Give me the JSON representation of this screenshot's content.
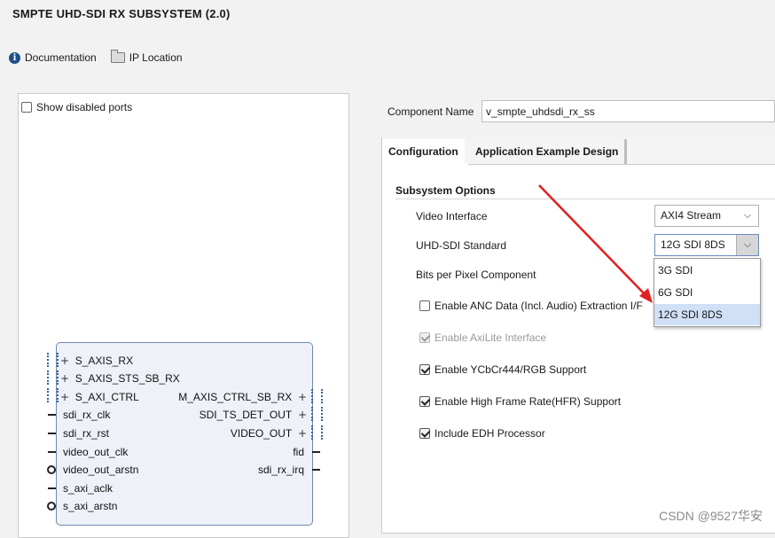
{
  "window": {
    "title": "SMPTE UHD-SDI RX SUBSYSTEM (2.0)"
  },
  "toolbar": {
    "documentation": "Documentation",
    "ip_location": "IP Location"
  },
  "left_panel": {
    "show_disabled_ports": "Show disabled ports",
    "block": {
      "left_ports": [
        "S_AXIS_RX",
        "S_AXIS_STS_SB_RX",
        "S_AXI_CTRL",
        "sdi_rx_clk",
        "sdi_rx_rst",
        "video_out_clk",
        "video_out_arstn",
        "s_axi_aclk",
        "s_axi_arstn"
      ],
      "right_ports": [
        "M_AXIS_CTRL_SB_RX",
        "SDI_TS_DET_OUT",
        "VIDEO_OUT",
        "fid",
        "sdi_rx_irq"
      ],
      "plus": "+"
    }
  },
  "component": {
    "label": "Component Name",
    "value": "v_smpte_uhdsdi_rx_ss"
  },
  "tabs": [
    {
      "label": "Configuration",
      "active": true
    },
    {
      "label": "Application Example Design",
      "active": false
    }
  ],
  "config": {
    "section_title": "Subsystem Options",
    "video_interface": {
      "label": "Video Interface",
      "value": "AXI4 Stream"
    },
    "uhd_sdi_standard": {
      "label": "UHD-SDI Standard",
      "value": "12G SDI 8DS",
      "options": [
        "3G SDI",
        "6G SDI",
        "12G SDI 8DS"
      ],
      "selected_index": 2
    },
    "bits_per_pixel": {
      "label": "Bits per Pixel Component"
    },
    "checkboxes": [
      {
        "label": "Enable ANC Data (Incl. Audio) Extraction I/F",
        "checked": false,
        "disabled": false
      },
      {
        "label": "Enable AxiLite Interface",
        "checked": true,
        "disabled": true
      },
      {
        "label": "Enable YCbCr444/RGB Support",
        "checked": true,
        "disabled": false
      },
      {
        "label": "Enable High Frame Rate(HFR) Support",
        "checked": true,
        "disabled": false
      },
      {
        "label": "Include EDH Processor",
        "checked": true,
        "disabled": false
      }
    ]
  },
  "annotation": {
    "arrow_color": "#e02020"
  },
  "watermark": "CSDN @9527华安"
}
